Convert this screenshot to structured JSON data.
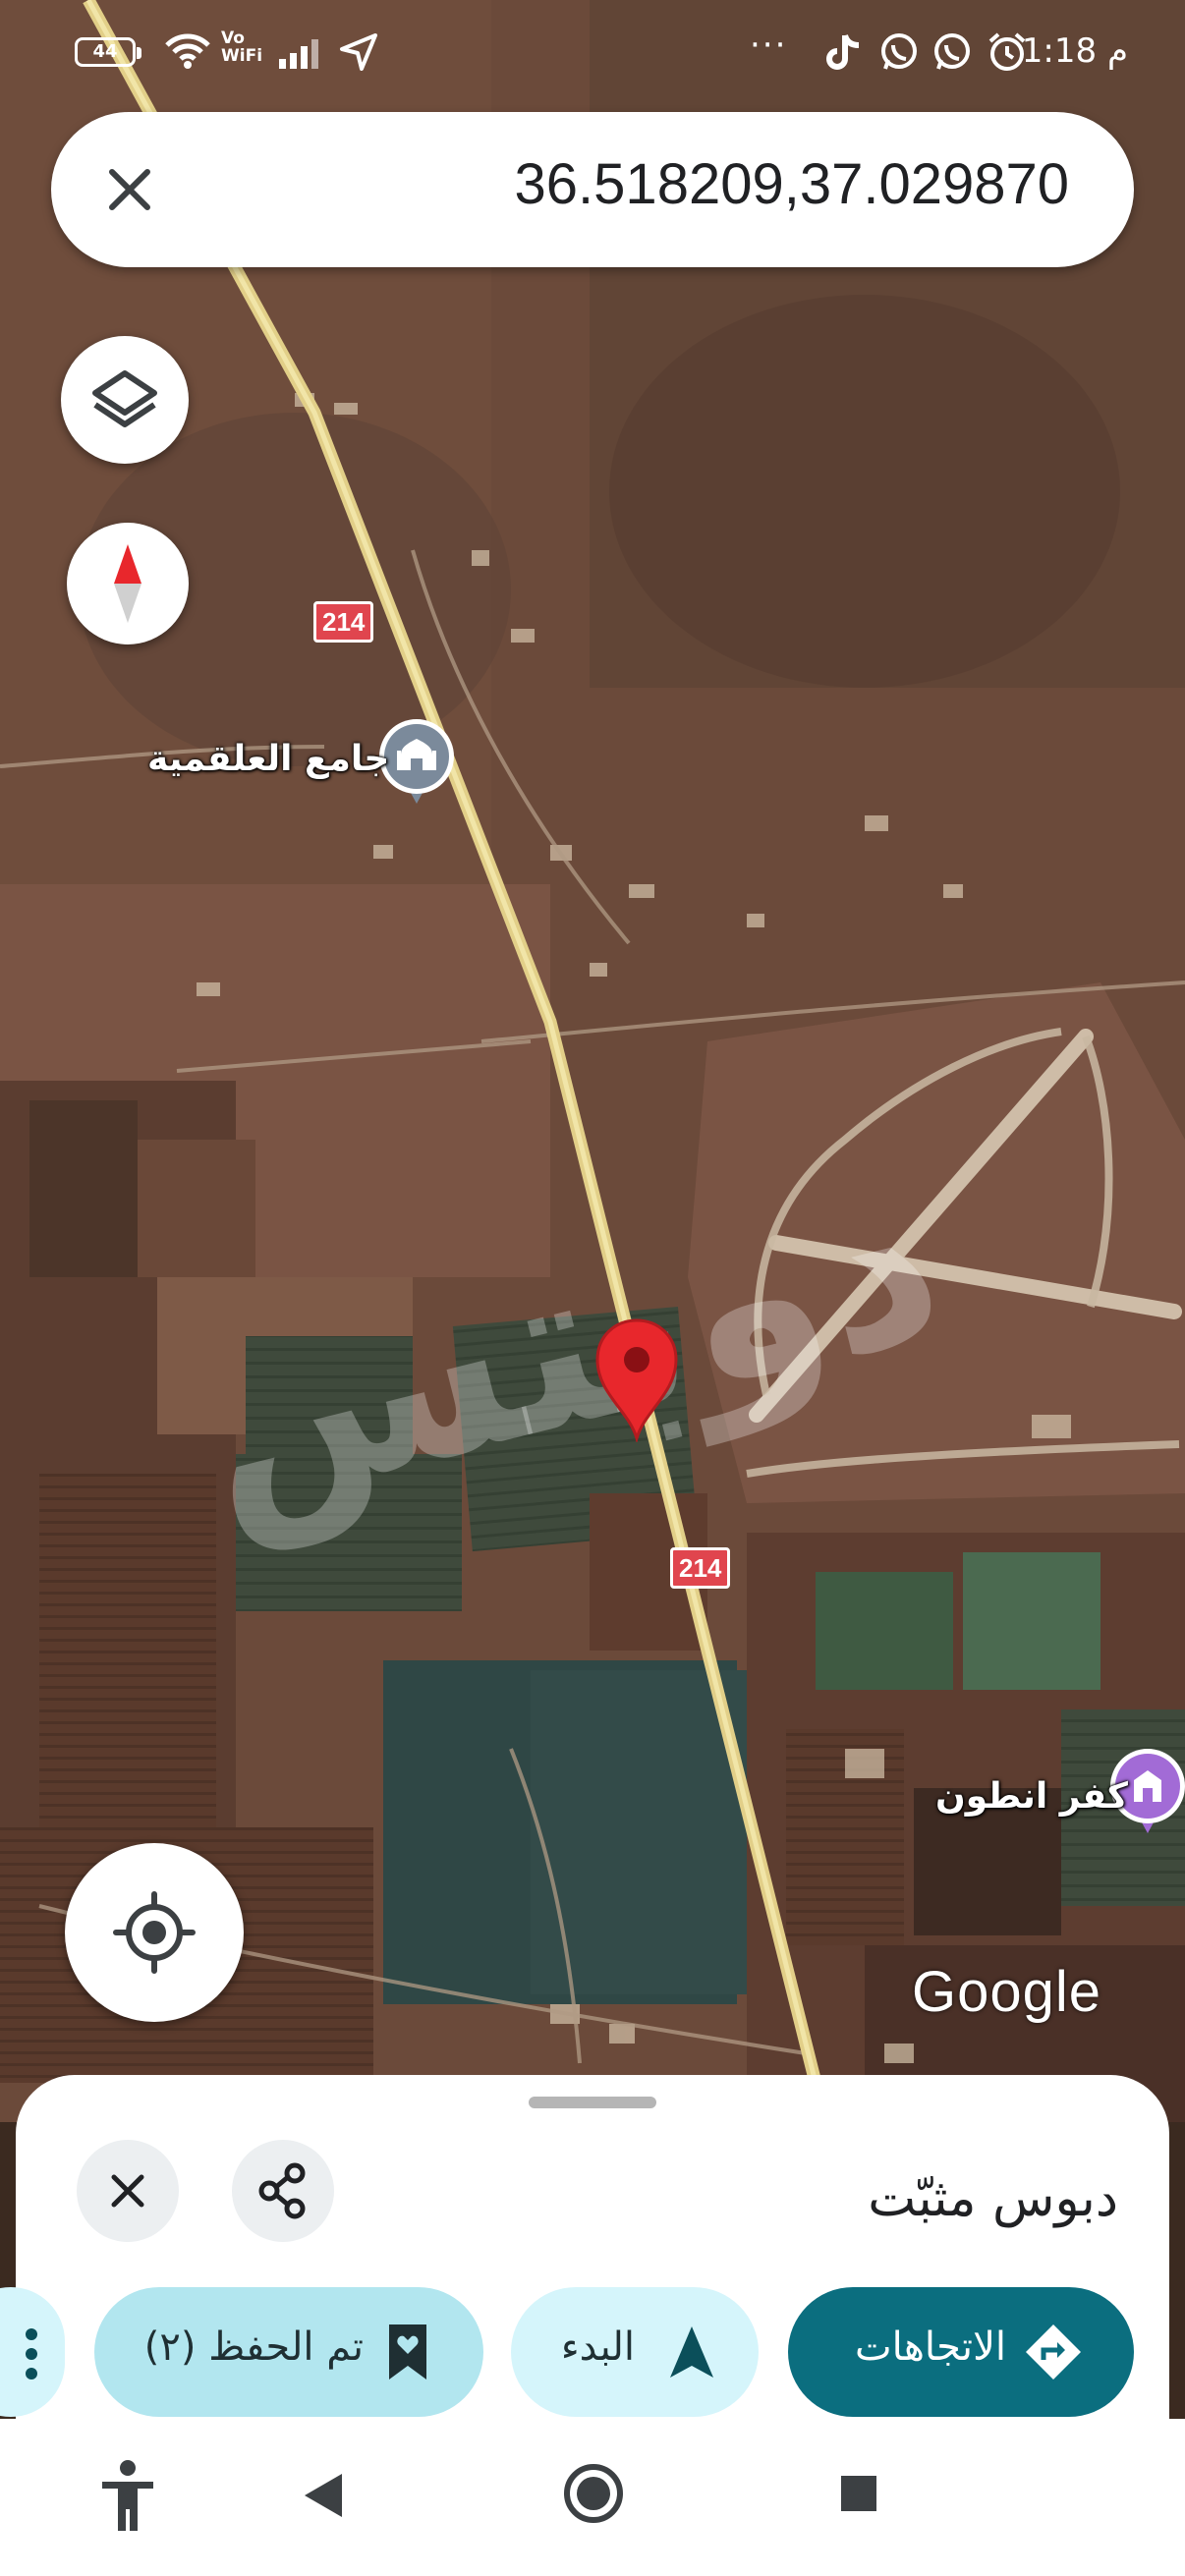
{
  "status_bar": {
    "battery": "44",
    "vowifi": "Vo WiFi",
    "overflow": "···",
    "time": "1:18 م",
    "icons": [
      "wifi-icon",
      "signal-icon",
      "location-arrow-icon",
      "tiktok-icon",
      "whatsapp-icon",
      "whatsapp-icon",
      "alarm-icon"
    ]
  },
  "search": {
    "query": "36.518209,37.029870",
    "close_icon": "close-icon"
  },
  "map": {
    "road_number": "214",
    "places": [
      {
        "name": "جامع العلقمية",
        "icon": "mosque-icon"
      },
      {
        "name": "كفر انطون",
        "icon": "place-icon"
      }
    ],
    "watermark": "دوبتس",
    "attribution": "Google",
    "pin_color": "#e8272c"
  },
  "controls": {
    "layers_icon": "layers-icon",
    "compass_icon": "compass-icon",
    "locate_icon": "my-location-icon"
  },
  "sheet": {
    "title": "دبوس مثبّت",
    "close_icon": "close-icon",
    "share_icon": "share-icon",
    "chips": {
      "directions": "الاتجاهات",
      "start": "البدء",
      "saved": "تم الحفظ (٢)"
    },
    "accent": "#0b6e7f"
  },
  "nav": {
    "icons": [
      "accessibility-icon",
      "back-icon",
      "home-icon",
      "recents-icon"
    ]
  }
}
